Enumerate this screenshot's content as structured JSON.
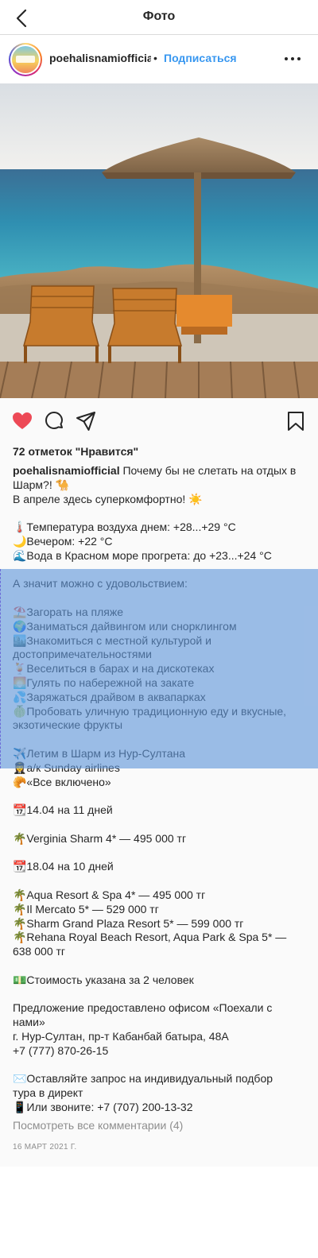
{
  "header": {
    "title": "Фото",
    "back_icon": "chevron-left-icon"
  },
  "post": {
    "username": "poehalisnamiofficial",
    "separator": "•",
    "follow_label": "Подписаться",
    "more_icon": "ellipsis-icon",
    "likes": "72 отметок \"Нравится\"",
    "liked": true,
    "like_color": "#ed4956",
    "link_color": "#3897f0",
    "caption_first_line_text": "Почему бы не слетать на отдых в",
    "caption_lines": [
      "Шарм?! 🐪",
      "В апреле здесь суперкомфортно! ☀️",
      "",
      "🌡️Температура воздуха днем: +28...+29 °С",
      "🌙Вечером: +22 °С",
      "🌊Вода в Красном море прогрета: до +23...+24 °С",
      "",
      "А значит можно с удовольствием:",
      "",
      "⛱️Загорать на пляже",
      "🌍Заниматься дайвингом или снорклингом",
      "🏙️Знакомиться с местной культурой и",
      "достопримечательностями",
      "🍹Веселиться в барах и на дискотеках",
      "🌅Гулять по набережной на закате",
      "💦Заряжаться драйвом в аквапарках",
      "🍈Пробовать уличную традиционную еду и вкусные,",
      "экзотические фрукты",
      "",
      "✈️Летим в Шарм из Нур-Султана",
      "👩‍✈️а/к Sunday airlines",
      "🥐«Все включено»",
      "",
      "📆14.04 на 11 дней",
      "",
      "🌴Verginia Sharm 4* — 495 000 тг",
      "",
      "📆18.04 на 10 дней",
      "",
      "🌴Aqua Resort & Spa 4* — 495 000 тг",
      "🌴Il Mercato 5* — 529 000 тг",
      "🌴Sharm Grand Plaza Resort 5* — 599 000 тг",
      "🌴Rehana Royal Beach Resort, Aqua Park & Spa 5* —",
      "638 000 тг",
      "",
      "💵Стоимость указана за 2 человек",
      "",
      "Предложение предоставлено офисом «Поехали с",
      "нами»",
      "г. Нур-Султан, пр-т Кабанбай батыра, 48А",
      "+7 (777) 870-26-15",
      "",
      "✉️Оставляйте запрос на индивидуальный подбор",
      "тура в директ",
      "📱Или звоните: +7 (707) 200-13-32"
    ],
    "view_comments": "Посмотреть все комментарии (4)",
    "date": "16 МАРТ 2021 Г."
  },
  "icons": {
    "like": "heart-icon",
    "comment": "comment-icon",
    "share": "paper-plane-icon",
    "save": "bookmark-icon"
  }
}
